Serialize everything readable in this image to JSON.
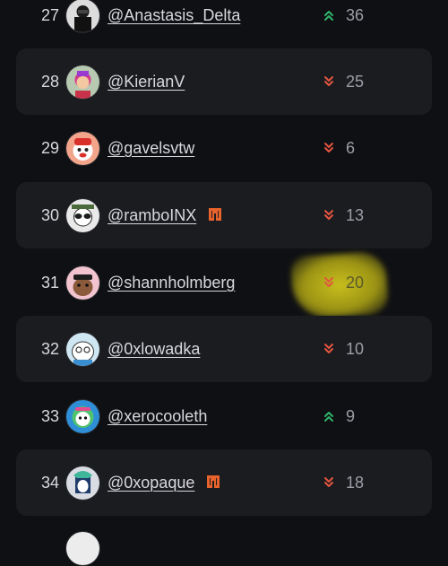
{
  "leaderboard": {
    "rows": [
      {
        "rank": "27",
        "handle": "@Anastasis_Delta",
        "trend": "up",
        "score": "36",
        "badge": false,
        "avatar": "avatar-anastasis",
        "shaded": false
      },
      {
        "rank": "28",
        "handle": "@KierianV",
        "trend": "down",
        "score": "25",
        "badge": false,
        "avatar": "avatar-kierianv",
        "shaded": true
      },
      {
        "rank": "29",
        "handle": "@gavelsvtw",
        "trend": "down",
        "score": "6",
        "badge": false,
        "avatar": "avatar-gavelsvtw",
        "shaded": false
      },
      {
        "rank": "30",
        "handle": "@ramboINX",
        "trend": "down",
        "score": "13",
        "badge": true,
        "avatar": "avatar-ramboinx",
        "shaded": true
      },
      {
        "rank": "31",
        "handle": "@shannholmberg",
        "trend": "down",
        "score": "20",
        "badge": false,
        "avatar": "avatar-shannholmberg",
        "shaded": false
      },
      {
        "rank": "32",
        "handle": "@0xlowadka",
        "trend": "down",
        "score": "10",
        "badge": false,
        "avatar": "avatar-0xlowadka",
        "shaded": true
      },
      {
        "rank": "33",
        "handle": "@xerocooleth",
        "trend": "up",
        "score": "9",
        "badge": false,
        "avatar": "avatar-xerocooleth",
        "shaded": false
      },
      {
        "rank": "34",
        "handle": "@0xopaque",
        "trend": "down",
        "score": "18",
        "badge": true,
        "avatar": "avatar-0xopaque",
        "shaded": true
      }
    ]
  },
  "colors": {
    "up": "#2fb36b",
    "down": "#e4553f",
    "badge": "#e8632b",
    "row_shade": "#1b1c20",
    "highlight": "#c9c01c"
  },
  "icons": {
    "up": "chevrons-up-icon",
    "down": "chevrons-down-icon",
    "badge": "partner-badge-icon"
  }
}
